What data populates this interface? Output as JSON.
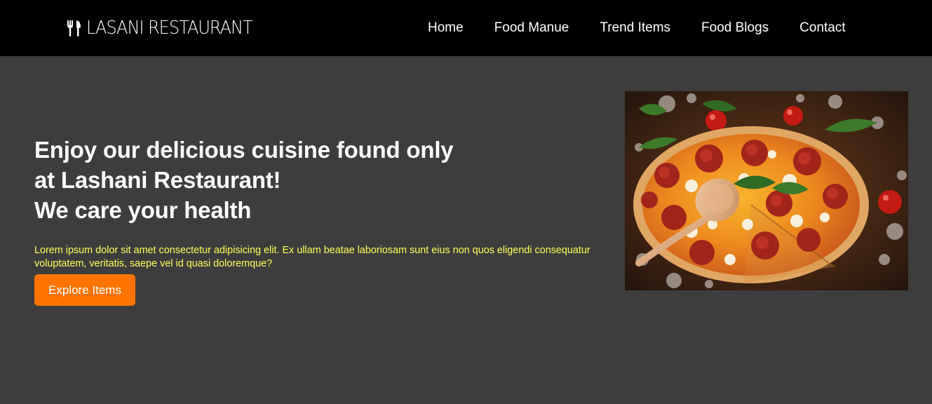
{
  "header": {
    "brand": {
      "icon": "fork-knife-icon",
      "name": "LASANI RESTAURANT"
    },
    "nav": [
      {
        "label": "Home"
      },
      {
        "label": "Food Manue"
      },
      {
        "label": "Trend Items"
      },
      {
        "label": "Food Blogs"
      },
      {
        "label": "Contact"
      }
    ]
  },
  "hero": {
    "heading_lines": [
      "Enjoy our delicious cuisine found only",
      "at Lashani Restaurant!",
      "We care your health"
    ],
    "paragraph": "Lorem ipsum dolor sit amet consectetur adipisicing elit. Ex ullam beatae laboriosam sunt eius non quos eligendi consequatur voluptatem, veritatis, saepe vel id quasi doloremque?",
    "cta_label": "Explore Items",
    "image": {
      "subject": "pepperoni-pizza-with-wooden-spoon"
    }
  },
  "colors": {
    "header_bg": "#000000",
    "page_bg": "#3d3d3d",
    "heading_text": "#ffffff",
    "paragraph_text": "#ffff5c",
    "cta_bg": "#ff7400"
  }
}
